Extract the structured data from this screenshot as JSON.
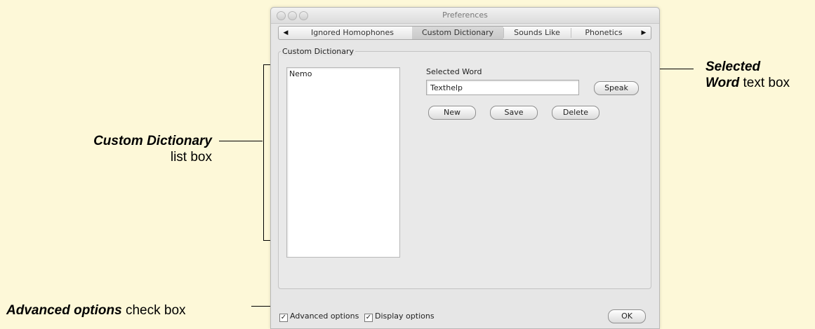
{
  "window": {
    "title": "Preferences",
    "tabs": [
      "Ignored Homophones",
      "Custom Dictionary",
      "Sounds Like",
      "Phonetics"
    ],
    "selected_tab": "Custom Dictionary",
    "group_label": "Custom Dictionary",
    "list_items": [
      "Nemo"
    ],
    "selected_word_label": "Selected Word",
    "selected_word_value": "Texthelp",
    "buttons": {
      "speak": "Speak",
      "new": "New",
      "save": "Save",
      "delete": "Delete",
      "ok": "OK"
    },
    "checkboxes": [
      {
        "label": "Advanced options",
        "checked": true,
        "mark": "✓"
      },
      {
        "label": "Display options",
        "checked": true,
        "mark": "✓"
      }
    ]
  },
  "callouts": {
    "custom_dictionary": {
      "bold": "Custom Dictionary",
      "rest": "list box"
    },
    "selected_word": {
      "bold1": "Selected",
      "bold2": "Word",
      "rest": " text box"
    },
    "advanced_options": {
      "bold": "Advanced options",
      "rest": " check box"
    }
  }
}
